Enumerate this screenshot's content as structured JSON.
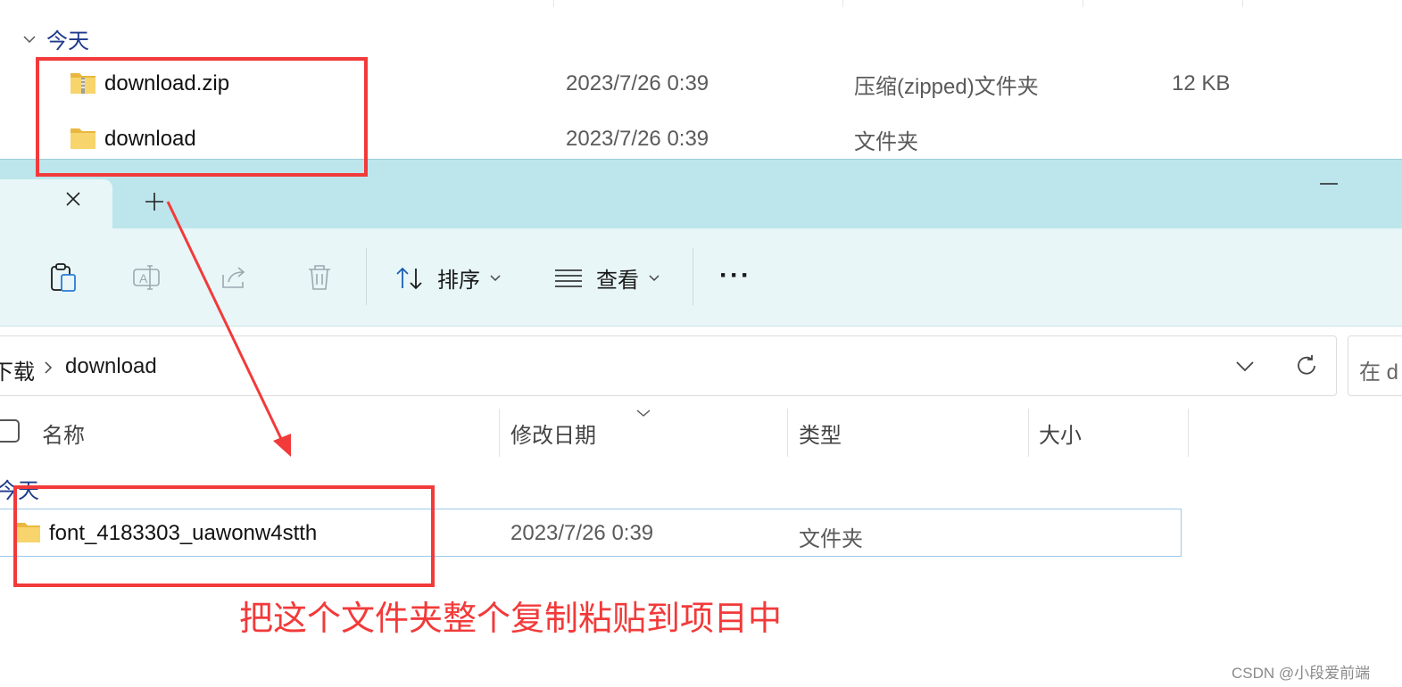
{
  "top_window": {
    "group_label": "今天",
    "files": [
      {
        "name": "download.zip",
        "date": "2023/7/26 0:39",
        "type": "压缩(zipped)文件夹",
        "size": "12 KB",
        "icon": "zip-folder-icon"
      },
      {
        "name": "download",
        "date": "2023/7/26 0:39",
        "type": "文件夹",
        "size": "",
        "icon": "folder-icon"
      }
    ]
  },
  "front_window": {
    "tabs": {
      "close": "close-tab-icon",
      "new": "new-tab-icon"
    },
    "toolbar": {
      "sort_label": "排序",
      "view_label": "查看",
      "more_label": "···"
    },
    "breadcrumb": {
      "parent": "下载",
      "current": "download"
    },
    "search_placeholder": "在 d",
    "columns": {
      "name": "名称",
      "modified": "修改日期",
      "type": "类型",
      "size": "大小"
    },
    "group_label": "今天",
    "files": [
      {
        "name": "font_4183303_uawonw4stth",
        "date": "2023/7/26 0:39",
        "type": "文件夹",
        "icon": "folder-icon"
      }
    ]
  },
  "annotation": {
    "note": "把这个文件夹整个复制粘贴到项目中",
    "color": "#f23a3a"
  },
  "watermark": "CSDN @小段爱前端",
  "colors": {
    "titlebar": "#bde6ec",
    "toolbar": "#e8f6f8",
    "group_label": "#1f3a8a",
    "selection_border": "#9cc9ea"
  }
}
